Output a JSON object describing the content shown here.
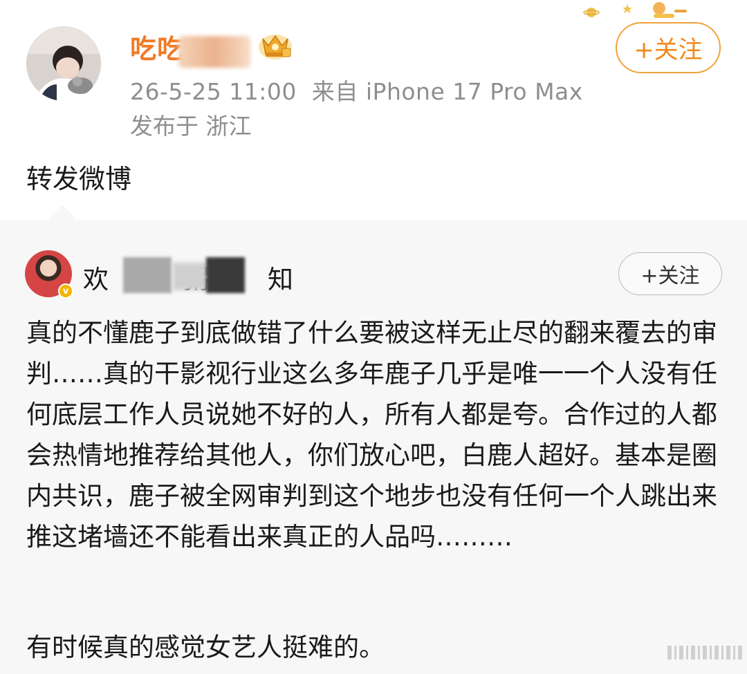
{
  "post": {
    "username": "吃吃",
    "timestamp": "26-5-25 11:00",
    "source": "来自 iPhone 17 Pro Max",
    "location": "发布于 浙江",
    "follow_label": "+关注",
    "text": "转发微博"
  },
  "quoted": {
    "username_prefix": "欢",
    "username_mid": "粥",
    "username_suffix": "知",
    "follow_label": "+关注",
    "body": "真的不懂鹿子到底做错了什么要被这样无止尽的翻来覆去的审判……真的干影视行业这么多年鹿子几乎是唯一一个人没有任何底层工作人员说她不好的人，所有人都是夸。合作过的人都会热情地推荐给其他人，你们放心吧，白鹿人超好。基本是圈内共识，鹿子被全网审判到这个地步也没有任何一个人跳出来推这堵墙还不能看出来真正的人品吗………",
    "body_last": "有时候真的感觉女艺人挺难的。"
  },
  "colors": {
    "accent_orange": "#f08a1e",
    "meta_gray": "#8e8e8e",
    "quote_bg": "#f7f7f7",
    "verified_badge": "#f5b400"
  },
  "icons": [
    "crown-vip-icon",
    "verified-badge-icon",
    "planet-decoration-icon"
  ]
}
